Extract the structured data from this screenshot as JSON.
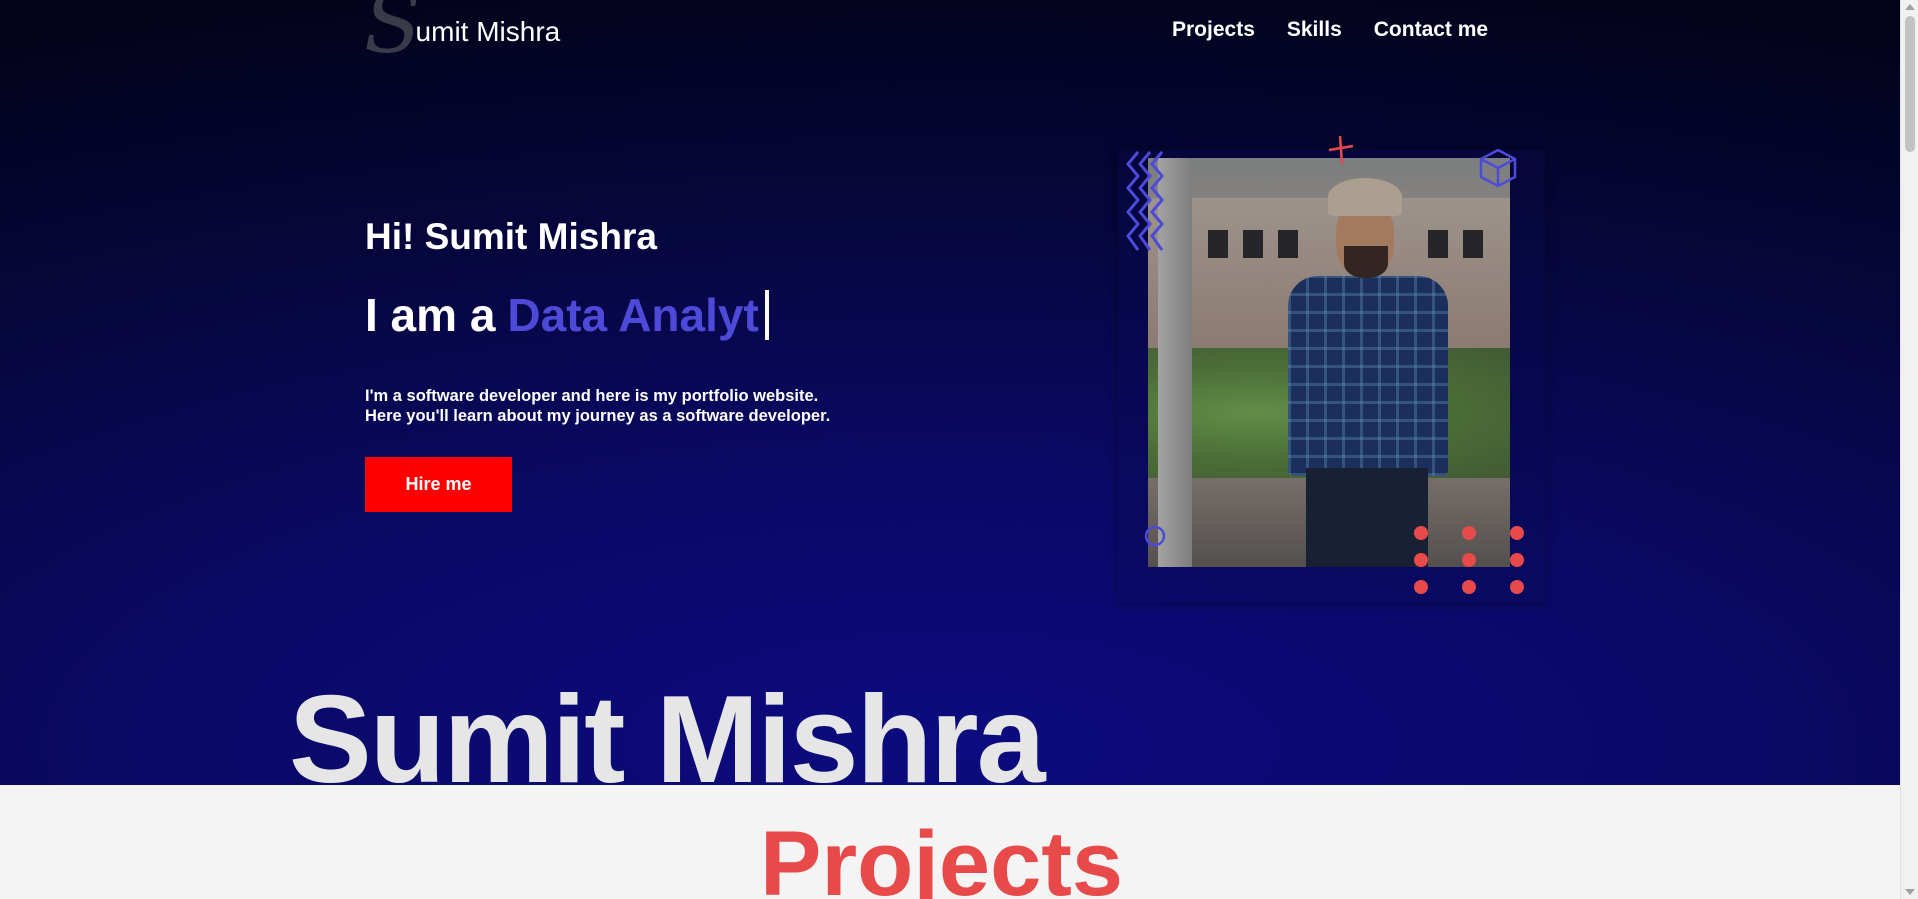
{
  "header": {
    "logo_initial": "S",
    "logo_text": "umit Mishra",
    "nav": [
      "Projects",
      "Skills",
      "Contact me"
    ]
  },
  "hero": {
    "greeting": "Hi! Sumit Mishra",
    "role_prefix": "I am a",
    "role_typed": "Data Analyt",
    "intro_line1": "I'm a software developer and here is my portfolio website.",
    "intro_line2": "Here you'll learn about my journey as a software developer.",
    "cta": "Hire me"
  },
  "background_word": "Sumit Mishra",
  "sections": {
    "projects_title": "Projects"
  },
  "colors": {
    "accent_purple": "#4d4ad9",
    "cta_red": "#ff0000",
    "dot_red": "#e84a4a",
    "hero_dark": "#06063a"
  },
  "icons": [
    "zigzag-icon",
    "plus-icon",
    "cube-icon",
    "circle-icon",
    "dot-grid-icon"
  ]
}
